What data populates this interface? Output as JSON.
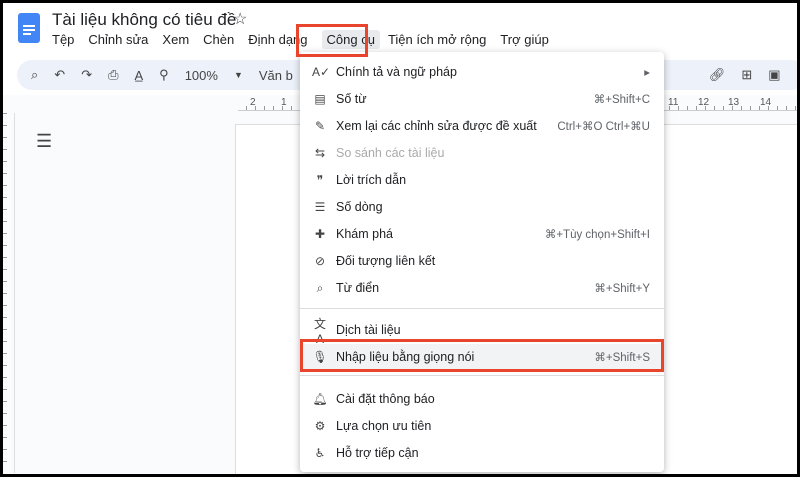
{
  "doc": {
    "title": "Tài liệu không có tiêu đề"
  },
  "menubar": [
    "Tệp",
    "Chỉnh sửa",
    "Xem",
    "Chèn",
    "Định dạng",
    "Công cụ",
    "Tiện ích mở rộng",
    "Trợ giúp"
  ],
  "toolbar": {
    "zoom": "100%",
    "style": "Văn b"
  },
  "ruler": [
    "2",
    "1",
    "11",
    "12",
    "13",
    "14"
  ],
  "menu": [
    {
      "label": "Chính tả và ngữ pháp",
      "icon": "spellcheck-icon",
      "shortcut": "▸"
    },
    {
      "label": "Số từ",
      "icon": "word-count-icon",
      "shortcut": "⌘+Shift+C"
    },
    {
      "label": "Xem lại các chỉnh sửa được đề xuất",
      "icon": "review-edits-icon",
      "shortcut": "Ctrl+⌘O Ctrl+⌘U"
    },
    {
      "label": "So sánh các tài liệu",
      "icon": "compare-icon",
      "shortcut": ""
    },
    {
      "label": "Lời trích dẫn",
      "icon": "quote-icon",
      "shortcut": ""
    },
    {
      "label": "Số dòng",
      "icon": "line-numbers-icon",
      "shortcut": ""
    },
    {
      "label": "Khám phá",
      "icon": "explore-icon",
      "shortcut": "⌘+Tùy chọn+Shift+I"
    },
    {
      "label": "Đối tượng liên kết",
      "icon": "linked-objects-icon",
      "shortcut": ""
    },
    {
      "label": "Từ điển",
      "icon": "dictionary-icon",
      "shortcut": "⌘+Shift+Y"
    },
    {
      "label": "Dịch tài liệu",
      "icon": "translate-icon",
      "shortcut": ""
    },
    {
      "label": "Nhập liệu bằng giọng nói",
      "icon": "microphone-icon",
      "shortcut": "⌘+Shift+S"
    },
    {
      "label": "Cài đặt thông báo",
      "icon": "bell-icon",
      "shortcut": ""
    },
    {
      "label": "Lựa chọn ưu tiên",
      "icon": "preferences-icon",
      "shortcut": ""
    },
    {
      "label": "Hỗ trợ tiếp cận",
      "icon": "accessibility-icon",
      "shortcut": ""
    }
  ]
}
